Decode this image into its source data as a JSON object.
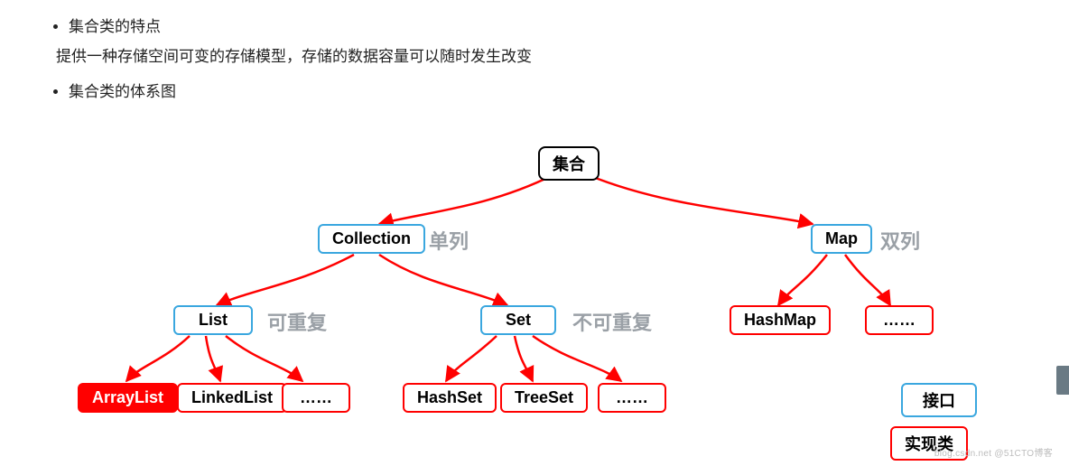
{
  "bullets": {
    "item1": "集合类的特点",
    "sub1": "提供一种存储空间可变的存储模型，存储的数据容量可以随时发生改变",
    "item2": "集合类的体系图"
  },
  "nodes": {
    "root": "集合",
    "collection": "Collection",
    "map": "Map",
    "list": "List",
    "set": "Set",
    "hashmap": "HashMap",
    "mapmore": "……",
    "arraylist": "ArrayList",
    "linkedlist": "LinkedList",
    "listmore": "……",
    "hashset": "HashSet",
    "treeset": "TreeSet",
    "setmore": "……",
    "legend_iface": "接口",
    "legend_impl": "实现类"
  },
  "annot": {
    "collection": "单列",
    "map": "双列",
    "list": "可重复",
    "set": "不可重复"
  },
  "watermark": "blog.csdn.net @51CTO博客",
  "chart_data": {
    "type": "tree-diagram",
    "title": "集合类的体系图",
    "legend": {
      "interface_box": "接口",
      "implementation_box": "实现类"
    },
    "root": {
      "name": "集合",
      "children": [
        {
          "name": "Collection",
          "kind": "interface",
          "note": "单列",
          "children": [
            {
              "name": "List",
              "kind": "interface",
              "note": "可重复",
              "children": [
                {
                  "name": "ArrayList",
                  "kind": "implementation",
                  "highlight": true
                },
                {
                  "name": "LinkedList",
                  "kind": "implementation"
                },
                {
                  "name": "……",
                  "kind": "implementation"
                }
              ]
            },
            {
              "name": "Set",
              "kind": "interface",
              "note": "不可重复",
              "children": [
                {
                  "name": "HashSet",
                  "kind": "implementation"
                },
                {
                  "name": "TreeSet",
                  "kind": "implementation"
                },
                {
                  "name": "……",
                  "kind": "implementation"
                }
              ]
            }
          ]
        },
        {
          "name": "Map",
          "kind": "interface",
          "note": "双列",
          "children": [
            {
              "name": "HashMap",
              "kind": "implementation"
            },
            {
              "name": "……",
              "kind": "implementation"
            }
          ]
        }
      ]
    }
  }
}
